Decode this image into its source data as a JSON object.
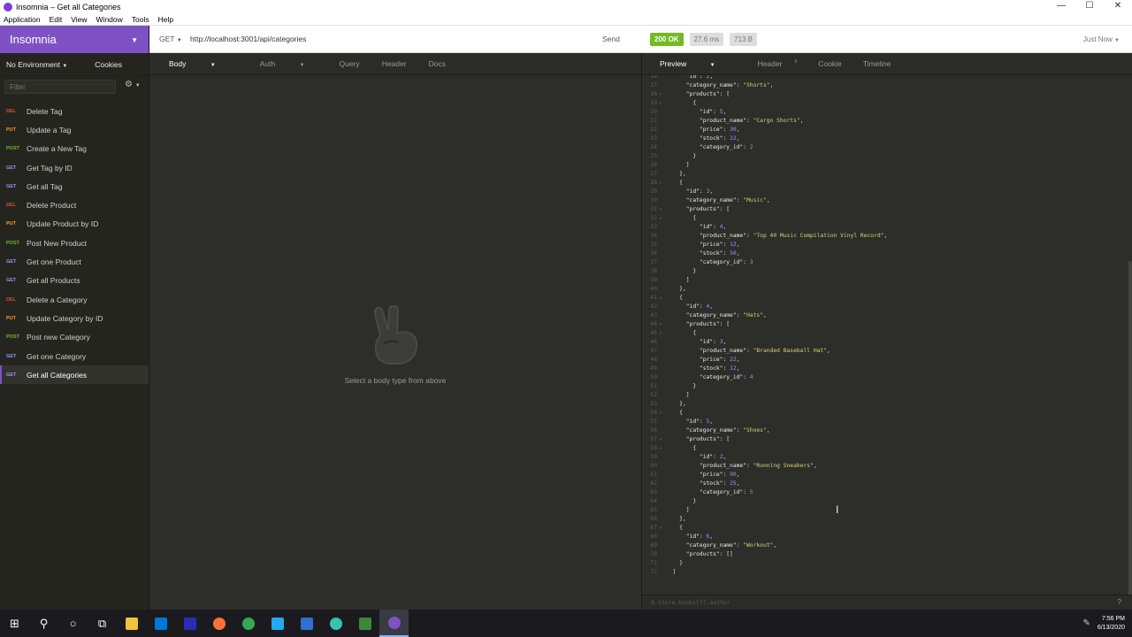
{
  "window": {
    "title": "Insomnia – Get all Categories",
    "controls": [
      "—",
      "☐",
      "✕"
    ]
  },
  "menu": [
    "Application",
    "Edit",
    "View",
    "Window",
    "Tools",
    "Help"
  ],
  "sidebar": {
    "workspace": "Insomnia",
    "environment": "No Environment",
    "cookies": "Cookies",
    "filter_placeholder": "Filter",
    "items": [
      {
        "method": "DEL",
        "label": "Delete Tag",
        "color": "#e04e2e"
      },
      {
        "method": "PUT",
        "label": "Update a Tag",
        "color": "#ff9a1f"
      },
      {
        "method": "POST",
        "label": "Create a New Tag",
        "color": "#75ba24"
      },
      {
        "method": "GET",
        "label": "Get Tag by ID",
        "color": "#8f9aff"
      },
      {
        "method": "GET",
        "label": "Get all Tag",
        "color": "#8f9aff"
      },
      {
        "method": "DEL",
        "label": "Delete Product",
        "color": "#e04e2e"
      },
      {
        "method": "PUT",
        "label": "Update Product by ID",
        "color": "#ff9a1f"
      },
      {
        "method": "POST",
        "label": "Post New Product",
        "color": "#75ba24"
      },
      {
        "method": "GET",
        "label": "Get one Product",
        "color": "#8f9aff"
      },
      {
        "method": "GET",
        "label": "Get all Products",
        "color": "#8f9aff"
      },
      {
        "method": "DEL",
        "label": "Delete a Category",
        "color": "#e04e2e"
      },
      {
        "method": "PUT",
        "label": "Update Category by ID",
        "color": "#ff9a1f"
      },
      {
        "method": "POST",
        "label": "Post new Category",
        "color": "#75ba24"
      },
      {
        "method": "GET",
        "label": "Get one Category",
        "color": "#8f9aff"
      },
      {
        "method": "GET",
        "label": "Get all Categories",
        "color": "#8f9aff",
        "active": true
      }
    ]
  },
  "request": {
    "method": "GET",
    "url": "http://localhost:3001/api/categories",
    "send": "Send",
    "tabs": [
      "Body",
      "Auth",
      "Query",
      "Header",
      "Docs"
    ],
    "empty_message": "Select a body type from above"
  },
  "response": {
    "status": "200 OK",
    "time": "27.6 ms",
    "size": "713 B",
    "when": "Just Now",
    "tabs": [
      "Preview",
      "Header",
      "Cookie",
      "Timeline"
    ],
    "header_count": "8",
    "filter_placeholder": "$.store.books[*].author",
    "help": "?",
    "lines": [
      {
        "n": "16",
        "t": "      \"id\": 2,",
        "f": ""
      },
      {
        "n": "17",
        "t": "      \"category_name\": \"Shorts\",",
        "f": ""
      },
      {
        "n": "18",
        "t": "      \"products\": [",
        "f": "▾"
      },
      {
        "n": "19",
        "t": "        {",
        "f": "▾"
      },
      {
        "n": "20",
        "t": "          \"id\": 5,",
        "f": ""
      },
      {
        "n": "21",
        "t": "          \"product_name\": \"Cargo Shorts\",",
        "f": ""
      },
      {
        "n": "22",
        "t": "          \"price\": 30,",
        "f": ""
      },
      {
        "n": "23",
        "t": "          \"stock\": 22,",
        "f": ""
      },
      {
        "n": "24",
        "t": "          \"category_id\": 2",
        "f": ""
      },
      {
        "n": "25",
        "t": "        }",
        "f": ""
      },
      {
        "n": "26",
        "t": "      ]",
        "f": ""
      },
      {
        "n": "27",
        "t": "    },",
        "f": ""
      },
      {
        "n": "28",
        "t": "    {",
        "f": "▾"
      },
      {
        "n": "29",
        "t": "      \"id\": 3,",
        "f": ""
      },
      {
        "n": "30",
        "t": "      \"category_name\": \"Music\",",
        "f": ""
      },
      {
        "n": "31",
        "t": "      \"products\": [",
        "f": "▾"
      },
      {
        "n": "32",
        "t": "        {",
        "f": "▾"
      },
      {
        "n": "33",
        "t": "          \"id\": 4,",
        "f": ""
      },
      {
        "n": "34",
        "t": "          \"product_name\": \"Top 40 Music Compilation Vinyl Record\",",
        "f": ""
      },
      {
        "n": "35",
        "t": "          \"price\": 12,",
        "f": ""
      },
      {
        "n": "36",
        "t": "          \"stock\": 50,",
        "f": ""
      },
      {
        "n": "37",
        "t": "          \"category_id\": 3",
        "f": ""
      },
      {
        "n": "38",
        "t": "        }",
        "f": ""
      },
      {
        "n": "39",
        "t": "      ]",
        "f": ""
      },
      {
        "n": "40",
        "t": "    },",
        "f": ""
      },
      {
        "n": "41",
        "t": "    {",
        "f": "▾"
      },
      {
        "n": "42",
        "t": "      \"id\": 4,",
        "f": ""
      },
      {
        "n": "43",
        "t": "      \"category_name\": \"Hats\",",
        "f": ""
      },
      {
        "n": "44",
        "t": "      \"products\": [",
        "f": "▾"
      },
      {
        "n": "45",
        "t": "        {",
        "f": "▾"
      },
      {
        "n": "46",
        "t": "          \"id\": 3,",
        "f": ""
      },
      {
        "n": "47",
        "t": "          \"product_name\": \"Branded Baseball Hat\",",
        "f": ""
      },
      {
        "n": "48",
        "t": "          \"price\": 22,",
        "f": ""
      },
      {
        "n": "49",
        "t": "          \"stock\": 12,",
        "f": ""
      },
      {
        "n": "50",
        "t": "          \"category_id\": 4",
        "f": ""
      },
      {
        "n": "51",
        "t": "        }",
        "f": ""
      },
      {
        "n": "52",
        "t": "      ]",
        "f": ""
      },
      {
        "n": "53",
        "t": "    },",
        "f": ""
      },
      {
        "n": "54",
        "t": "    {",
        "f": "▾"
      },
      {
        "n": "55",
        "t": "      \"id\": 5,",
        "f": ""
      },
      {
        "n": "56",
        "t": "      \"category_name\": \"Shoes\",",
        "f": ""
      },
      {
        "n": "57",
        "t": "      \"products\": [",
        "f": "▾"
      },
      {
        "n": "58",
        "t": "        {",
        "f": "▾"
      },
      {
        "n": "59",
        "t": "          \"id\": 2,",
        "f": ""
      },
      {
        "n": "60",
        "t": "          \"product_name\": \"Running Sneakers\",",
        "f": ""
      },
      {
        "n": "61",
        "t": "          \"price\": 90,",
        "f": ""
      },
      {
        "n": "62",
        "t": "          \"stock\": 25,",
        "f": ""
      },
      {
        "n": "63",
        "t": "          \"category_id\": 5",
        "f": ""
      },
      {
        "n": "64",
        "t": "        }",
        "f": ""
      },
      {
        "n": "65",
        "t": "      ]",
        "f": ""
      },
      {
        "n": "66",
        "t": "    },",
        "f": ""
      },
      {
        "n": "67",
        "t": "    {",
        "f": "▾"
      },
      {
        "n": "68",
        "t": "      \"id\": 6,",
        "f": ""
      },
      {
        "n": "69",
        "t": "      \"category_name\": \"Workout\",",
        "f": ""
      },
      {
        "n": "70",
        "t": "      \"products\": []",
        "f": ""
      },
      {
        "n": "71",
        "t": "    }",
        "f": ""
      },
      {
        "n": "72",
        "t": "  ]",
        "f": ""
      }
    ]
  },
  "taskbar": {
    "time": "7:56 PM",
    "date": "6/13/2020",
    "apps": [
      {
        "name": "start-icon",
        "color": "#ffffff"
      },
      {
        "name": "search-icon",
        "color": "#ffffff"
      },
      {
        "name": "cortana-icon",
        "color": "#ffffff"
      },
      {
        "name": "task-view-icon",
        "color": "#ffffff"
      },
      {
        "name": "file-explorer-icon",
        "color": "#f3c13a"
      },
      {
        "name": "store-icon",
        "color": "#0078d7"
      },
      {
        "name": "amazon-music-icon",
        "color": "#2d2bb5"
      },
      {
        "name": "firefox-icon",
        "color": "#ff7139"
      },
      {
        "name": "chrome-icon",
        "color": "#34a853"
      },
      {
        "name": "vscode-icon",
        "color": "#23a9f2"
      },
      {
        "name": "sourcetree-icon",
        "color": "#2f6fd6"
      },
      {
        "name": "slack-icon",
        "color": "#36c5ab"
      },
      {
        "name": "node-icon",
        "color": "#3c873a"
      },
      {
        "name": "insomnia-icon",
        "color": "#7e52c4"
      }
    ]
  }
}
